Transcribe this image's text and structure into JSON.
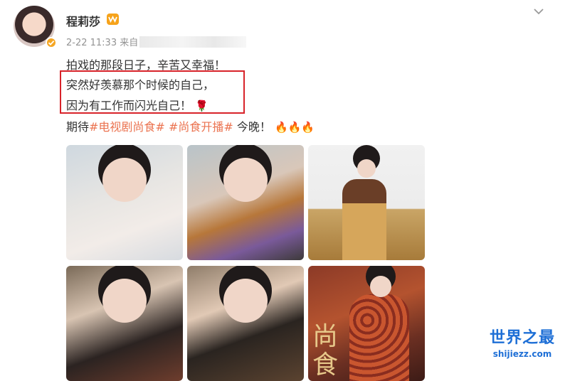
{
  "post": {
    "username": "程莉莎",
    "timestamp": "2-22 11:33",
    "source_prefix": "来自",
    "line1": "拍戏的那段日子，辛苦又幸福！",
    "line2": "突然好羡慕那个时候的自己，",
    "line3_text": "因为有工作而闪光自己！",
    "line3_emoji": "🌹",
    "line4_prefix": "期待",
    "topic1": "#电视剧尚食#",
    "topic2": "#尚食开播#",
    "line4_suffix": "今晚！",
    "line4_emoji": "🔥🔥🔥",
    "highlight_color": "#d8232a",
    "topic_color": "#eb7350"
  },
  "photos": {
    "p6_poster_text": "尚食"
  },
  "icons": {
    "avatar": "avatar-image",
    "verified": "verified-badge-icon",
    "vip": "vip-badge-icon",
    "more": "chevron-down-icon"
  },
  "watermark": {
    "title": "世界之最",
    "url": "shijiezz.com"
  }
}
